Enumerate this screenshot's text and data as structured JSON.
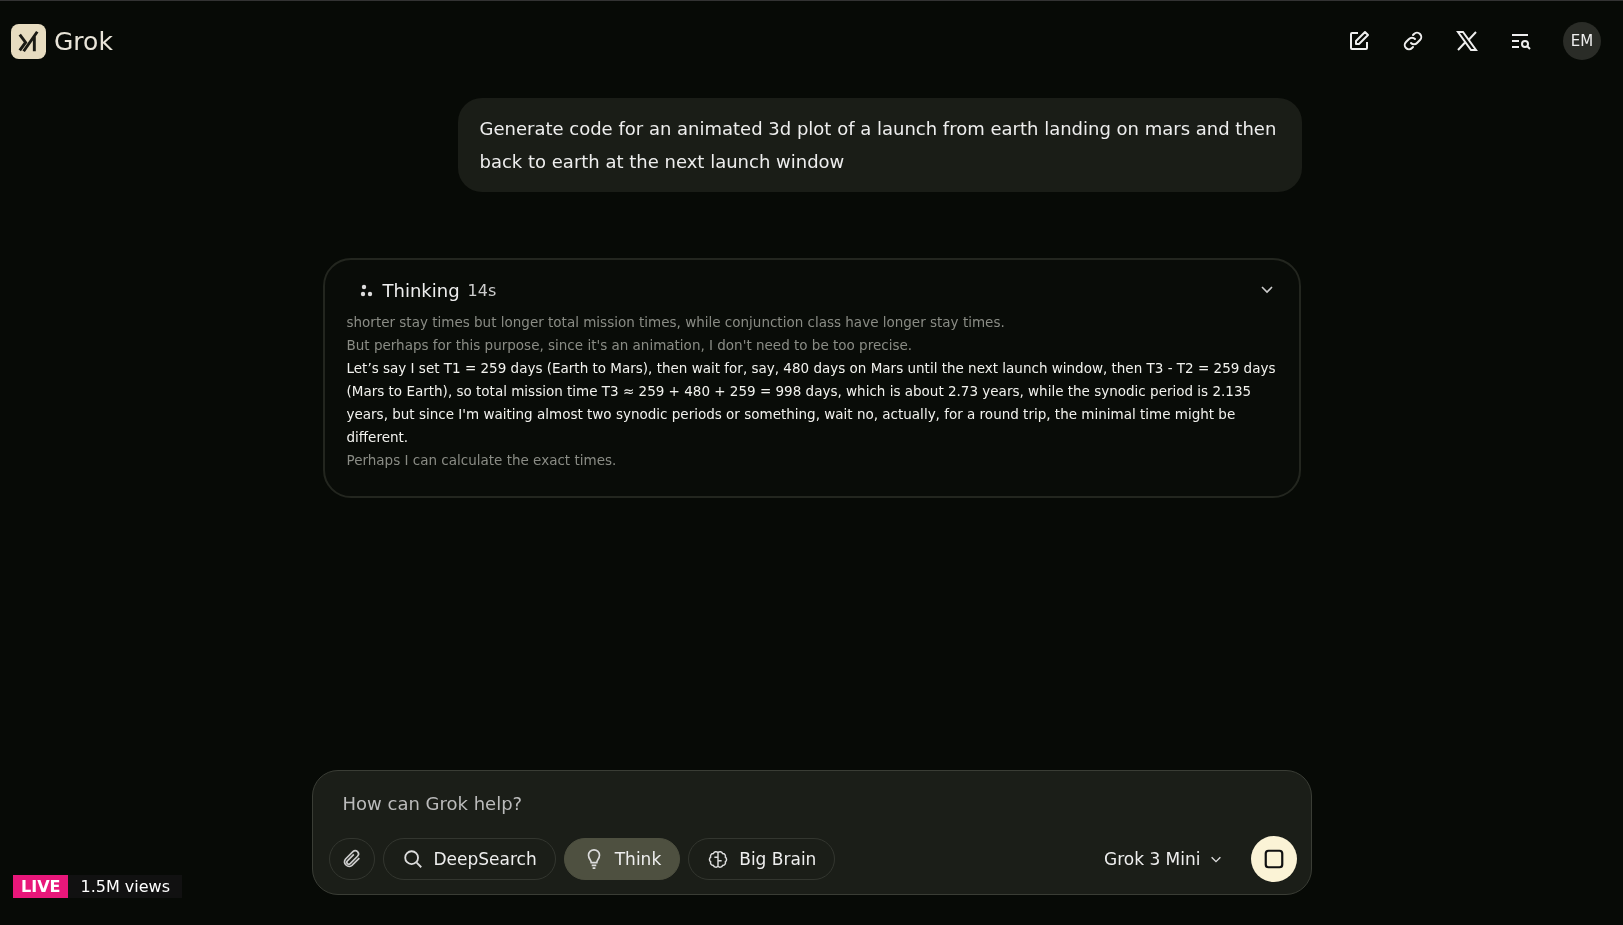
{
  "header": {
    "brand": "Grok",
    "avatar": "EM"
  },
  "prompt": "Generate code for an animated 3d plot of a launch from earth landing on mars and then back to earth at the next launch window",
  "thinking": {
    "label": "Thinking",
    "duration": "14s",
    "expanded": true,
    "lines": [
      {
        "text": "shorter stay times but longer total mission times, while conjunction class have longer stay times.",
        "current": false
      },
      {
        "text": "But perhaps for this purpose, since it's an animation, I don't need to be too precise.",
        "current": false
      },
      {
        "text": "Let’s say I set T1 = 259 days (Earth to Mars), then wait for, say, 480 days on Mars until the next launch window, then T3 - T2 = 259 days (Mars to Earth), so total mission time T3 ≈ 259 + 480 + 259 = 998 days, which is about 2.73 years, while the synodic period is 2.135 years, but since I'm waiting almost two synodic periods or something, wait no, actually, for a round trip, the minimal time might be different.",
        "current": true
      },
      {
        "text": "Perhaps I can calculate the exact times.",
        "current": false
      }
    ]
  },
  "composer": {
    "placeholder": "How can Grok help?",
    "modes": [
      {
        "label": "DeepSearch",
        "kind": "search",
        "selected": false
      },
      {
        "label": "Think",
        "kind": "bulb",
        "selected": true
      },
      {
        "label": "Big Brain",
        "kind": "brain",
        "selected": false
      }
    ],
    "model": "Grok 3 Mini"
  },
  "live": {
    "badge": "LIVE",
    "views": "1.5M views"
  }
}
